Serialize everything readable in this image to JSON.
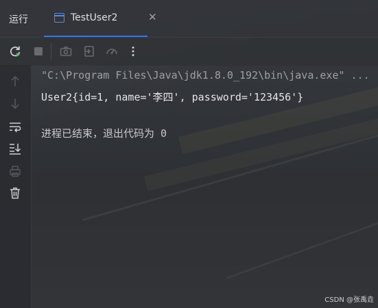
{
  "title_bar": {
    "run_label": "运行",
    "tab": {
      "label": "TestUser2"
    }
  },
  "toolbar": {
    "buttons": [
      "rerun-icon",
      "stop-icon",
      "camera-icon",
      "exit-icon",
      "gauge-icon",
      "more-icon"
    ]
  },
  "sidebar": {
    "buttons": [
      "up-arrow-icon",
      "down-arrow-icon",
      "soft-wrap-icon",
      "scroll-to-end-icon",
      "print-icon",
      "trash-icon"
    ]
  },
  "console": {
    "command_line": "\"C:\\Program Files\\Java\\jdk1.8.0_192\\bin\\java.exe\" ...",
    "output_line": "User2{id=1, name='李四', password='123456'}",
    "exit_line": "进程已结束，退出代码为 0"
  },
  "watermark": "CSDN @张禹垚",
  "colors": {
    "accent": "#3574f0",
    "run_green": "#5fb865",
    "text": "#e4e6ea",
    "muted": "#9ea0a6"
  }
}
